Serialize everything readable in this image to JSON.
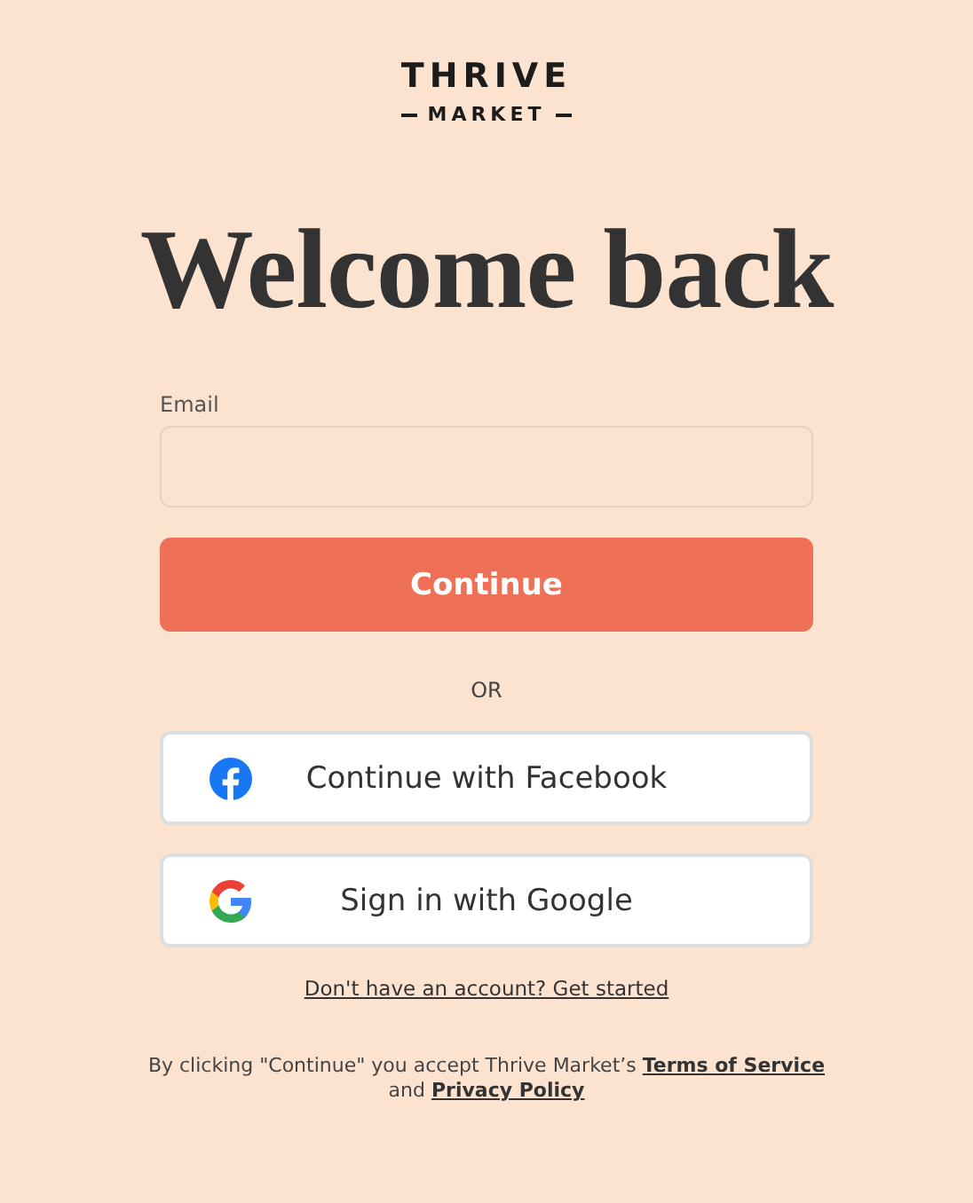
{
  "logo": {
    "top": "THRIVE",
    "bottom": "MARKET"
  },
  "heading": "Welcome back",
  "email": {
    "label": "Email"
  },
  "continue_button": "Continue",
  "divider": "OR",
  "social_buttons": [
    {
      "kind": "facebook",
      "label": "Continue with Facebook"
    },
    {
      "kind": "google",
      "label": "Sign in with Google"
    }
  ],
  "signup_link": "Don't have an account? Get started",
  "legal": {
    "prefix": "By clicking \"Continue\" you accept Thrive Market’s",
    "terms": "Terms of Service",
    "middle": "and",
    "privacy": "Privacy Policy"
  }
}
